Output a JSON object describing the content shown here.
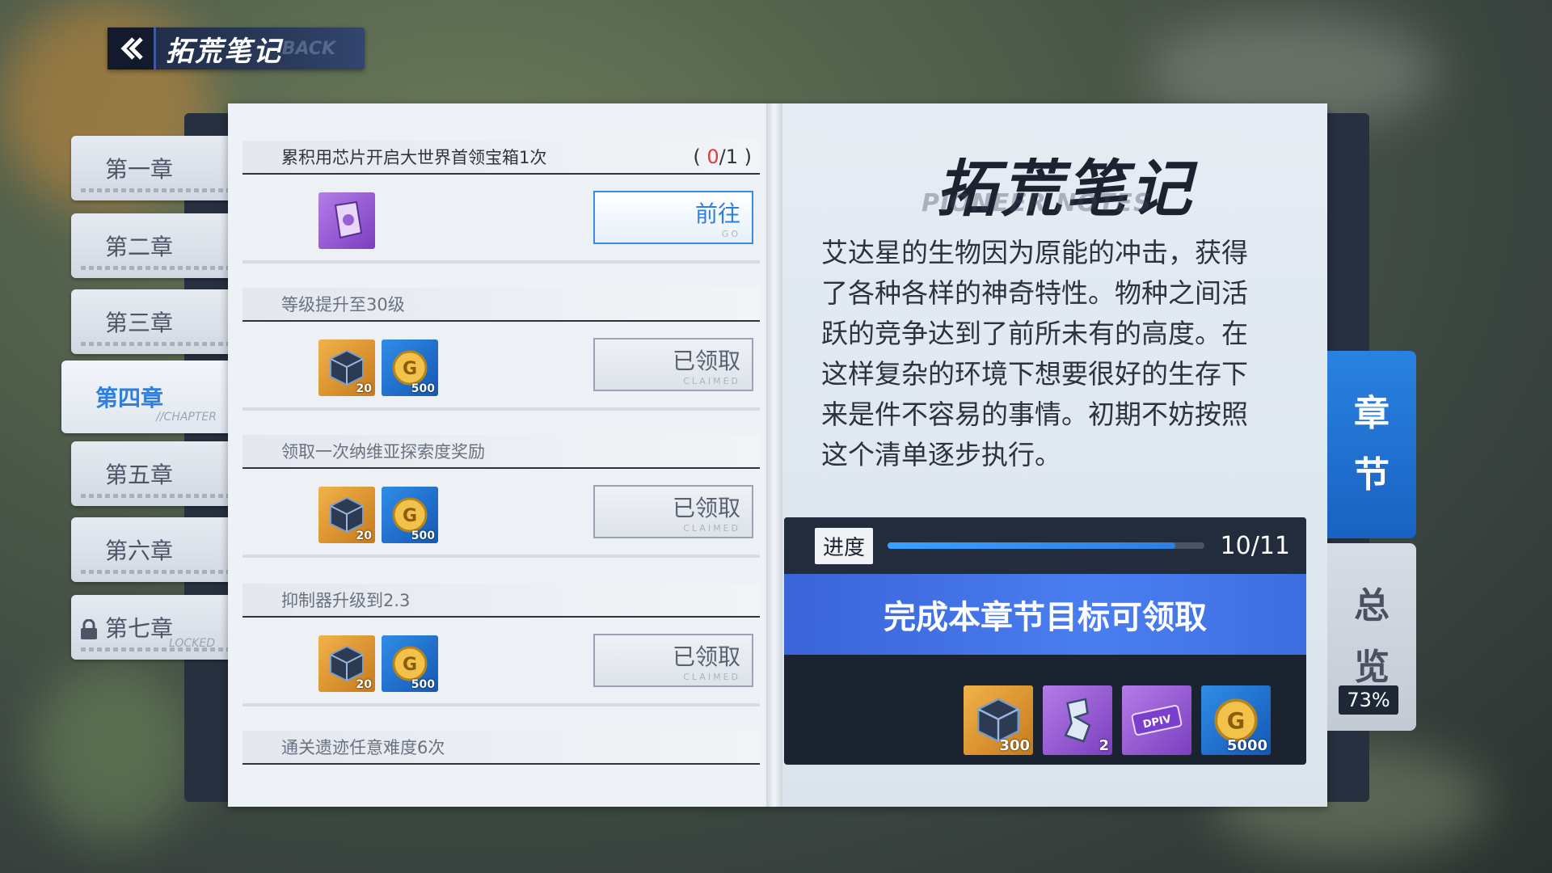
{
  "header": {
    "title": "拓荒笔记",
    "title_bg": "BACK"
  },
  "chapters": [
    {
      "label": "第一章"
    },
    {
      "label": "第二章"
    },
    {
      "label": "第三章"
    },
    {
      "label": "第四章",
      "sub": "//CHAPTER",
      "active": true
    },
    {
      "label": "第五章"
    },
    {
      "label": "第六章"
    },
    {
      "label": "第七章",
      "sub": "LOCKED",
      "locked": true
    }
  ],
  "tasks": [
    {
      "title": "累积用芯片开启大世界首领宝箱1次",
      "progress_current": "0",
      "progress_total": "/1",
      "button_label": "前往",
      "button_sub": "GO",
      "rewards": [
        {
          "icon": "chip-icon",
          "color": "purple",
          "count": ""
        }
      ]
    },
    {
      "title": "等级提升至30级",
      "button_label": "已领取",
      "button_sub": "CLAIMED",
      "rewards": [
        {
          "icon": "cube-icon",
          "color": "orange",
          "count": "20"
        },
        {
          "icon": "gold-coin-icon",
          "color": "blue",
          "count": "500"
        }
      ]
    },
    {
      "title": "领取一次纳维亚探索度奖励",
      "button_label": "已领取",
      "button_sub": "CLAIMED",
      "rewards": [
        {
          "icon": "cube-icon",
          "color": "orange",
          "count": "20"
        },
        {
          "icon": "gold-coin-icon",
          "color": "blue",
          "count": "500"
        }
      ]
    },
    {
      "title": "抑制器升级到2.3",
      "button_label": "已领取",
      "button_sub": "CLAIMED",
      "rewards": [
        {
          "icon": "cube-icon",
          "color": "orange",
          "count": "20"
        },
        {
          "icon": "gold-coin-icon",
          "color": "blue",
          "count": "500"
        }
      ]
    },
    {
      "title": "通关遗迹任意难度6次"
    }
  ],
  "notes": {
    "title": "拓荒笔记",
    "subtitle": "PIONEER NOTES",
    "description": "艾达星的生物因为原能的冲击，获得了各种各样的神奇特性。物种之间活跃的竞争达到了前所未有的高度。在这样复杂的环境下想要很好的生存下来是件不容易的事情。初期不妨按照这个清单逐步执行。"
  },
  "progress": {
    "label": "进度",
    "text": "10/11",
    "fraction": 0.909,
    "claim_text": "完成本章节目标可领取",
    "rewards": [
      {
        "icon": "cube-icon",
        "color": "orange",
        "count": "300"
      },
      {
        "icon": "vehicle-part-icon",
        "color": "purple",
        "count": "2"
      },
      {
        "icon": "dpiv-ticket-icon",
        "color": "purple",
        "count": ""
      },
      {
        "icon": "gold-coin-icon",
        "color": "blue",
        "count": "5000"
      }
    ]
  },
  "side_tabs": {
    "chapter": [
      "章",
      "节"
    ],
    "overview": [
      "总",
      "览"
    ],
    "overview_percent": "73%"
  },
  "colors": {
    "accent_blue": "#2f7fe0",
    "progress_red": "#e23b3b",
    "claim_blue": "#4a7ef0"
  }
}
